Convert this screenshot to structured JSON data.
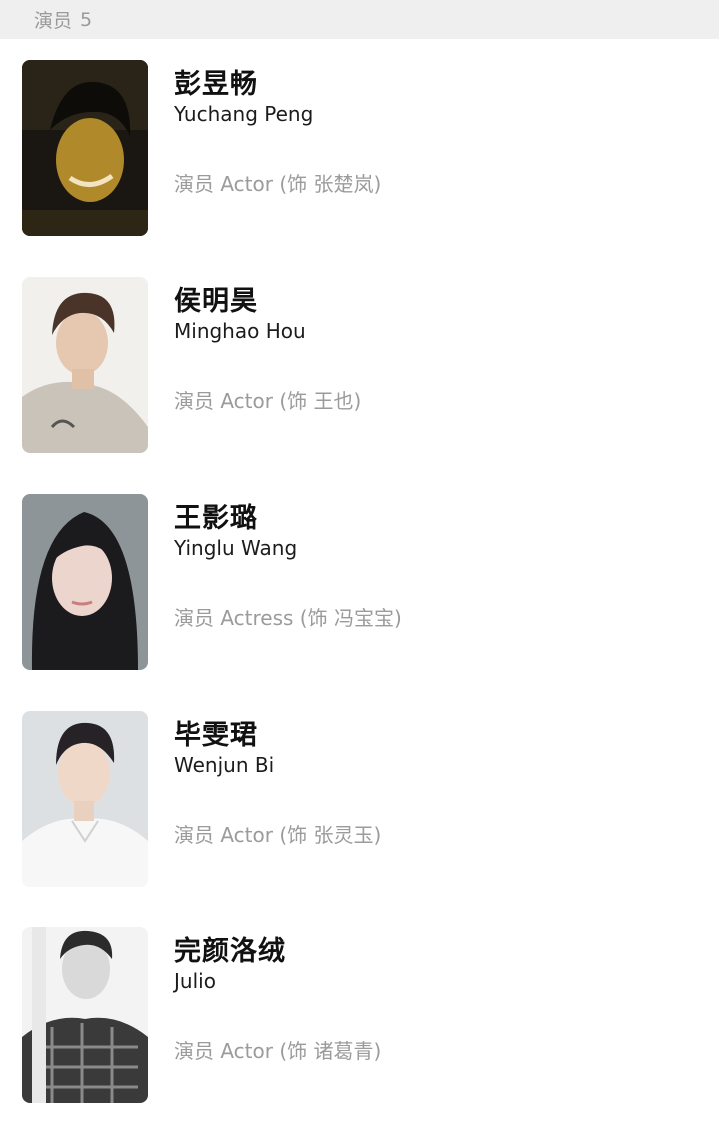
{
  "section": {
    "title": "演员",
    "count": "5"
  },
  "cast": [
    {
      "name_cn": "彭昱畅",
      "name_en": "Yuchang Peng",
      "role": "演员 Actor (饰 张楚岚)"
    },
    {
      "name_cn": "侯明昊",
      "name_en": "Minghao Hou",
      "role": "演员 Actor (饰 王也)"
    },
    {
      "name_cn": "王影璐",
      "name_en": "Yinglu Wang",
      "role": "演员 Actress (饰 冯宝宝)"
    },
    {
      "name_cn": "毕雯珺",
      "name_en": "Wenjun Bi",
      "role": "演员 Actor (饰 张灵玉)"
    },
    {
      "name_cn": "完颜洛绒",
      "name_en": "Julio",
      "role": "演员 Actor (饰 诸葛青)"
    }
  ]
}
